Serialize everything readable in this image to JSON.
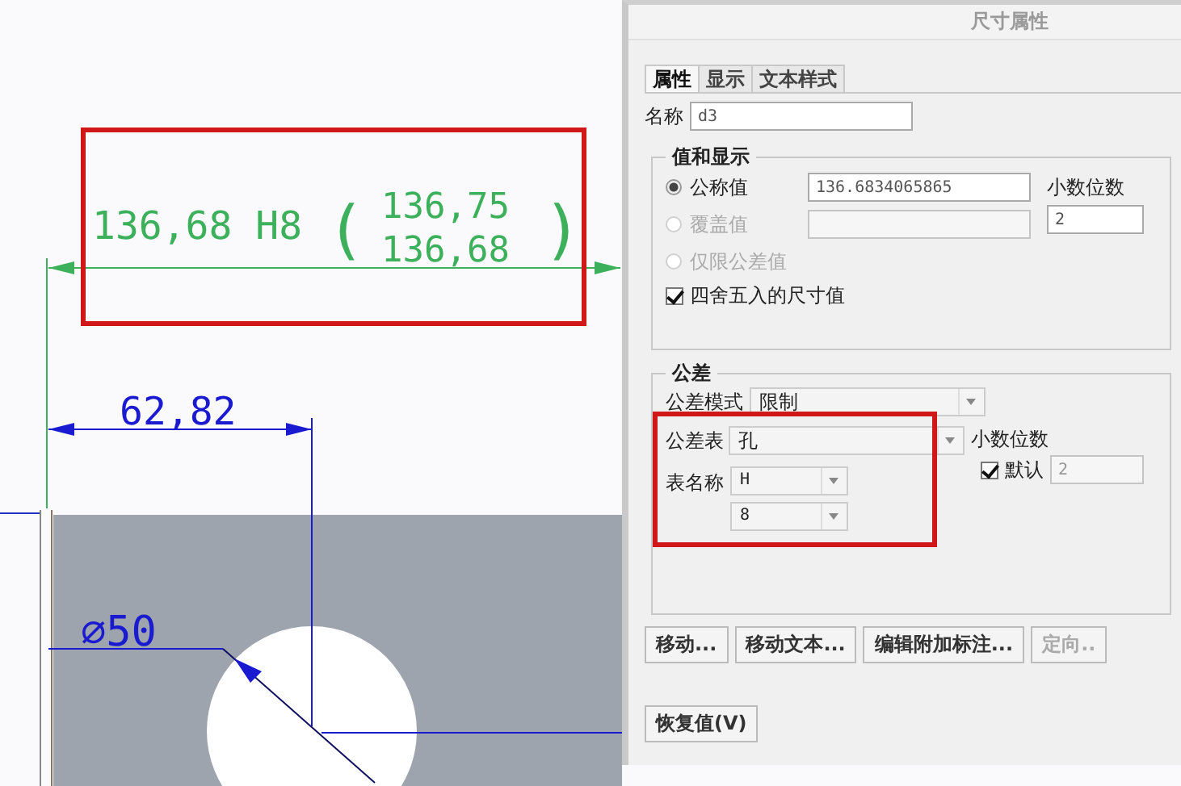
{
  "drawing": {
    "fit_dimension": {
      "nominal": "136,68 H8",
      "open": "(",
      "upper": "136,75",
      "lower": "136,68",
      "close": ")"
    },
    "distance_dimension": "62,82",
    "diameter_dimension": "⌀50"
  },
  "dialog": {
    "title": "尺寸属性",
    "tabs": [
      {
        "label": "属性",
        "selected": true
      },
      {
        "label": "显示",
        "selected": false
      },
      {
        "label": "文本样式",
        "selected": false
      }
    ],
    "name": {
      "label": "名称",
      "value": "d3"
    },
    "value_group": {
      "title": "值和显示",
      "options": [
        {
          "label": "公称值",
          "selected": true,
          "disabled": false,
          "value": "136.6834065865"
        },
        {
          "label": "覆盖值",
          "selected": false,
          "disabled": true
        },
        {
          "label": "仅限公差值",
          "selected": false,
          "disabled": true
        }
      ],
      "decimals": {
        "label": "小数位数",
        "value": "2"
      },
      "round": {
        "label": "四舍五入的尺寸值",
        "checked": true
      }
    },
    "tolerance_group": {
      "title": "公差",
      "mode": {
        "label": "公差模式",
        "value": "限制"
      },
      "table": {
        "label": "公差表",
        "value": "孔"
      },
      "table_name": {
        "label": "表名称",
        "values": [
          "H",
          "8"
        ]
      },
      "decimals": {
        "label": "小数位数",
        "default": {
          "label": "默认",
          "checked": true
        },
        "value": "2"
      }
    },
    "buttons": [
      {
        "label": "移动...",
        "disabled": false
      },
      {
        "label": "移动文本...",
        "disabled": false
      },
      {
        "label": "编辑附加标注...",
        "disabled": false
      },
      {
        "label": "定向..",
        "disabled": true
      }
    ],
    "restore_button": "恢复值(V)"
  }
}
